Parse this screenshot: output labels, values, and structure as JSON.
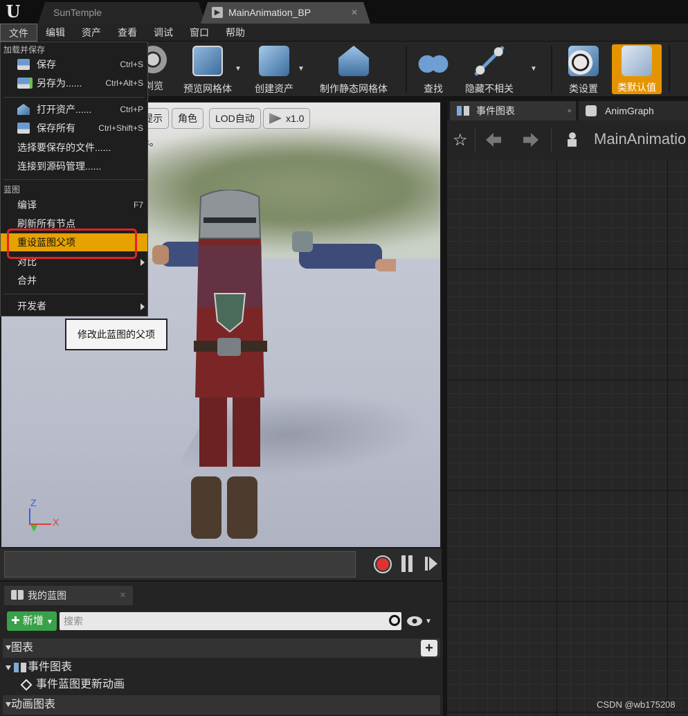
{
  "tabs": [
    {
      "label": "SunTemple"
    },
    {
      "label": "MainAnimation_BP"
    }
  ],
  "menu": [
    "文件",
    "编辑",
    "资产",
    "查看",
    "调试",
    "窗口",
    "帮助"
  ],
  "toolbar": {
    "buttons": [
      {
        "label": "浏览"
      },
      {
        "label": "预览网格体"
      },
      {
        "label": "创建资产"
      },
      {
        "label": "制作静态网格体"
      },
      {
        "label": "查找"
      },
      {
        "label": "隐藏不相关"
      },
      {
        "label": "类设置"
      },
      {
        "label": "类默认值"
      }
    ],
    "active_color": "#e59400"
  },
  "file_menu": {
    "section1": "加载并保存",
    "save": {
      "label": "保存",
      "shortcut": "Ctrl+S"
    },
    "save_as": {
      "label": "另存为......",
      "shortcut": "Ctrl+Alt+S"
    },
    "open_asset": {
      "label": "打开资产......",
      "shortcut": "Ctrl+P"
    },
    "save_all": {
      "label": "保存所有",
      "shortcut": "Ctrl+Shift+S"
    },
    "choose_files": {
      "label": "选择要保存的文件......"
    },
    "source_control": {
      "label": "连接到源码管理......"
    },
    "section2": "蓝图",
    "compile": {
      "label": "编译",
      "shortcut": "F7"
    },
    "refresh_nodes": {
      "label": "刷新所有节点"
    },
    "reparent": {
      "label": "重设蓝图父项"
    },
    "diff": {
      "label": "对比"
    },
    "merge": {
      "label": "合并"
    },
    "developer": {
      "label": "开发者"
    },
    "highlight_color": "#e6a200"
  },
  "tooltip": "修改此蓝图的父项",
  "viewport": {
    "chips": [
      "提示",
      "角色",
      "LOD自动",
      "x1.0"
    ],
    "note": "c。",
    "axis_z": "Z",
    "axis_x": "X"
  },
  "my_blueprint": {
    "tab": "我的蓝图",
    "add_label": "新增",
    "search_placeholder": "搜索",
    "graphs_header": "图表",
    "event_graph": "事件图表",
    "event_node": "事件蓝图更新动画",
    "anim_graphs_header": "动画图表"
  },
  "graph": {
    "tab_event": "事件图表",
    "tab_anim": "AnimGraph",
    "breadcrumb": "MainAnimatio"
  },
  "watermark": "CSDN @wb175208"
}
